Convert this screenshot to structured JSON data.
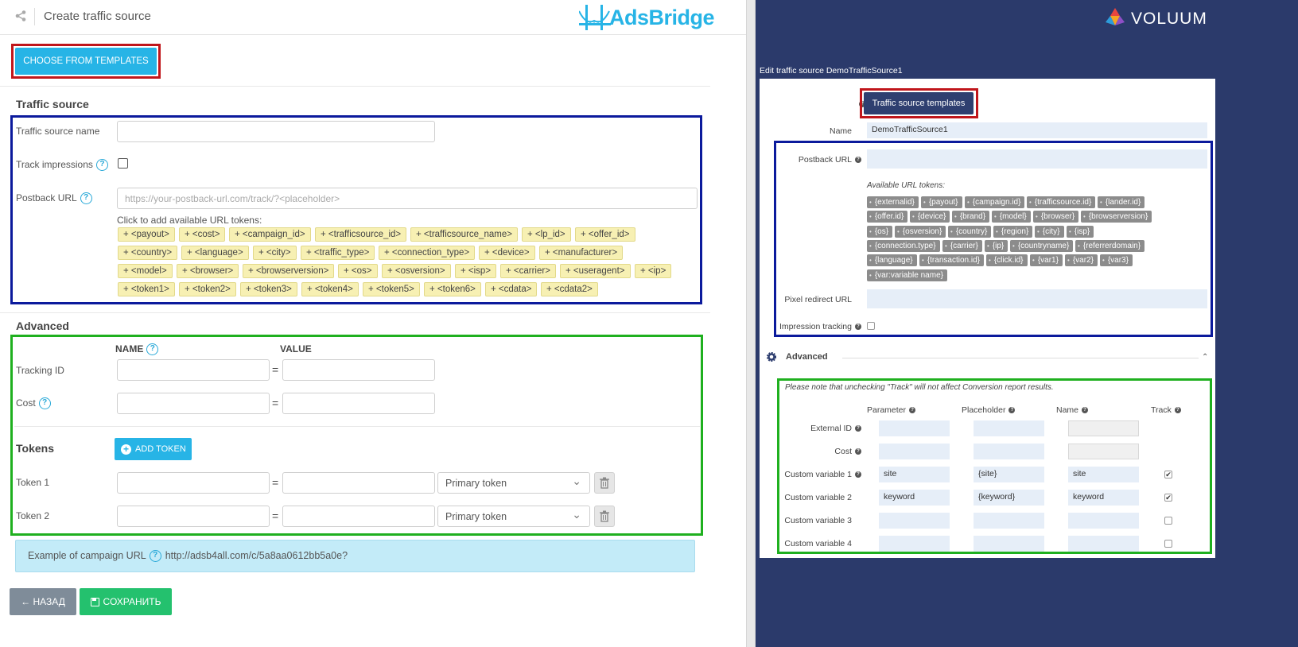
{
  "left": {
    "header_title": "Create traffic source",
    "logo_text": "AdsBridge",
    "choose_templates_label": "CHOOSE FROM TEMPLATES",
    "traffic_source_title": "Traffic source",
    "name_label": "Traffic source name",
    "track_impressions_label": "Track impressions",
    "postback_label": "Postback URL",
    "postback_placeholder": "https://your-postback-url.com/track/?<placeholder>",
    "tokens_hint": "Click to add available URL tokens:",
    "url_tokens": [
      [
        "+ <payout>",
        "+ <cost>",
        "+ <campaign_id>",
        "+ <trafficsource_id>",
        "+ <trafficsource_name>",
        "+ <lp_id>",
        "+ <offer_id>"
      ],
      [
        "+ <country>",
        "+ <language>",
        "+ <city>",
        "+ <traffic_type>",
        "+ <connection_type>",
        "+ <device>",
        "+ <manufacturer>"
      ],
      [
        "+ <model>",
        "+ <browser>",
        "+ <browserversion>",
        "+ <os>",
        "+ <osversion>",
        "+ <isp>",
        "+ <carrier>",
        "+ <useragent>",
        "+ <ip>"
      ],
      [
        "+ <token1>",
        "+ <token2>",
        "+ <token3>",
        "+ <token4>",
        "+ <token5>",
        "+ <token6>",
        "+ <cdata>",
        "+ <cdata2>"
      ]
    ],
    "advanced_title": "Advanced",
    "col_name": "NAME",
    "col_value": "VALUE",
    "tracking_id_label": "Tracking ID",
    "cost_label": "Cost",
    "tokens_title": "Tokens",
    "add_token_label": "ADD TOKEN",
    "token1_label": "Token 1",
    "token2_label": "Token 2",
    "token_type_value": "Primary token",
    "example_label": "Example of campaign URL",
    "example_url": "http://adsb4all.com/c/5a8aa0612bb5a0e?",
    "back_label": "← НАЗАД",
    "save_label": "СОХРАНИТЬ"
  },
  "right": {
    "logo_text": "VOLUUM",
    "edit_title": "Edit traffic source DemoTrafficSource1",
    "templates_button": "Traffic source templates",
    "name_label": "Name",
    "name_value": "DemoTrafficSource1",
    "postback_label": "Postback URL",
    "available_tokens_label": "Available URL tokens:",
    "url_tokens": [
      [
        "{externalid}",
        "{payout}",
        "{campaign.id}",
        "{trafficsource.id}",
        "{lander.id}"
      ],
      [
        "{offer.id}",
        "{device}",
        "{brand}",
        "{model}",
        "{browser}",
        "{browserversion}"
      ],
      [
        "{os}",
        "{osversion}",
        "{country}",
        "{region}",
        "{city}",
        "{isp}"
      ],
      [
        "{connection.type}",
        "{carrier}",
        "{ip}",
        "{countryname}",
        "{referrerdomain}"
      ],
      [
        "{language}",
        "{transaction.id}",
        "{click.id}",
        "{var1}",
        "{var2}",
        "{var3}"
      ],
      [
        "{var:variable name}"
      ]
    ],
    "pixel_redirect_label": "Pixel redirect URL",
    "impression_tracking_label": "Impression tracking",
    "advanced_label": "Advanced",
    "note": "Please note that unchecking \"Track\" will not affect Conversion report results.",
    "columns": [
      "Parameter",
      "Placeholder",
      "Name",
      "Track"
    ],
    "rows": [
      {
        "label": "External ID",
        "parameter": "",
        "placeholder": "",
        "name": "",
        "track": null
      },
      {
        "label": "Cost",
        "parameter": "",
        "placeholder": "",
        "name": "",
        "track": null
      },
      {
        "label": "Custom variable 1",
        "parameter": "site",
        "placeholder": "{site}",
        "name": "site",
        "track": true
      },
      {
        "label": "Custom variable 2",
        "parameter": "keyword",
        "placeholder": "{keyword}",
        "name": "keyword",
        "track": true
      },
      {
        "label": "Custom variable 3",
        "parameter": "",
        "placeholder": "",
        "name": "",
        "track": false
      },
      {
        "label": "Custom variable 4",
        "parameter": "",
        "placeholder": "",
        "name": "",
        "track": false
      }
    ]
  },
  "colors": {
    "adsbridge_blue": "#27b4e6",
    "voluum_bg": "#2b3a6b",
    "voluum_button": "#2f3f70",
    "red_highlight": "#c0161b",
    "blue_highlight": "#0b1a9c",
    "green_highlight": "#1fb01f",
    "save_green": "#24c16e",
    "token_yellow": "#f7f0b3"
  }
}
